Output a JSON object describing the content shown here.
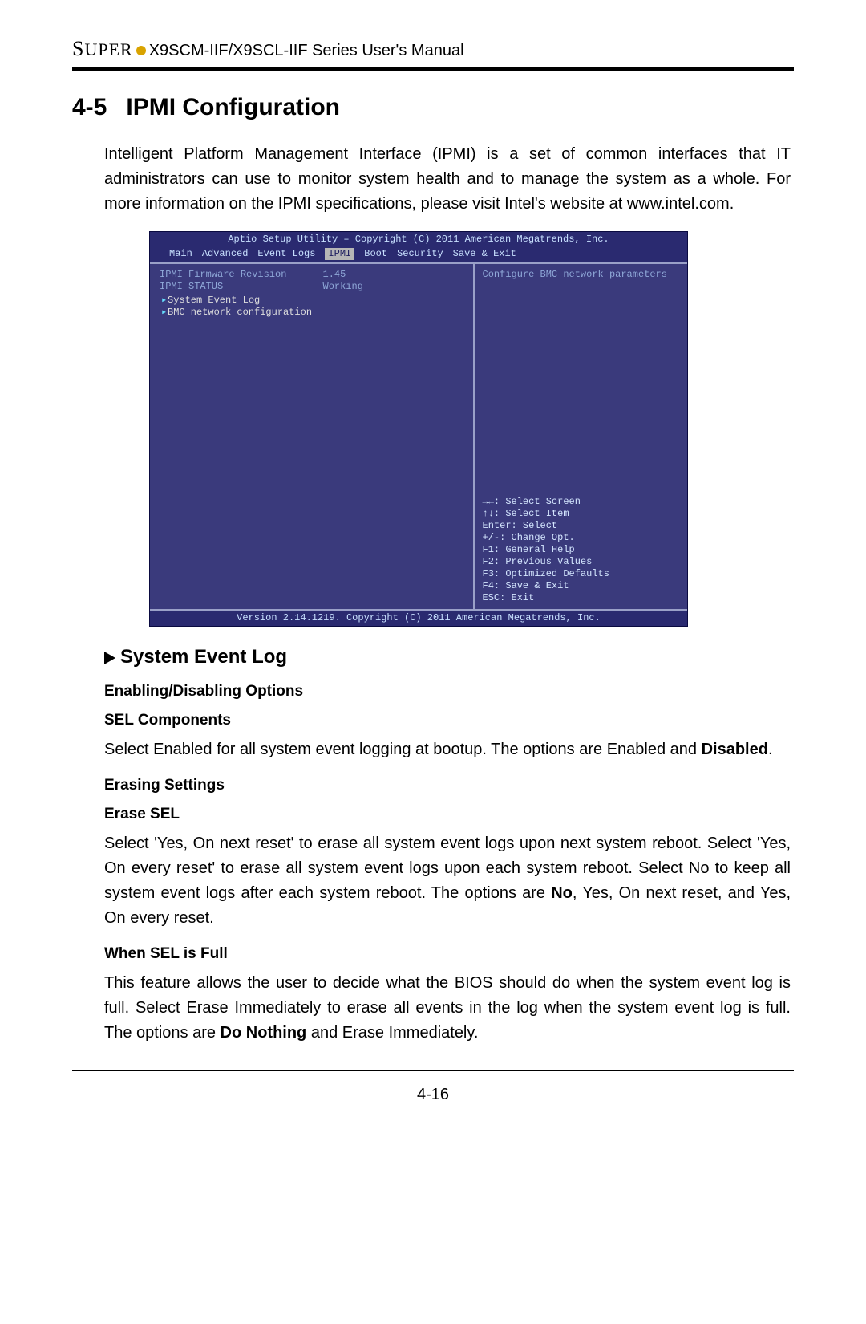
{
  "header": {
    "brand": "SUPER",
    "title": "X9SCM-IIF/X9SCL-IIF Series User's Manual"
  },
  "section": {
    "number": "4-5",
    "title": "IPMI Configuration",
    "intro": "Intelligent Platform Management Interface (IPMI) is a set of common interfaces that IT administrators can use to monitor system health and to manage the system as a whole. For more information on the IPMI specifications, please visit Intel's website at www.intel.com."
  },
  "bios": {
    "topbar": "Aptio Setup Utility – Copyright (C) 2011 American Megatrends, Inc.",
    "menu": [
      "Main",
      "Advanced",
      "Event Logs",
      "IPMI",
      "Boot",
      "Security",
      "Save & Exit"
    ],
    "menu_selected": "IPMI",
    "rows": [
      {
        "label": "IPMI Firmware Revision",
        "value": "1.45"
      },
      {
        "label": "IPMI STATUS",
        "value": "Working"
      }
    ],
    "subitems": [
      "System Event Log",
      "BMC network configuration"
    ],
    "help_top": "Configure BMC network parameters",
    "help_keys": [
      "→←: Select Screen",
      "↑↓: Select Item",
      "Enter: Select",
      "+/-: Change Opt.",
      "F1: General Help",
      "F2: Previous Values",
      "F3: Optimized Defaults",
      "F4: Save & Exit",
      "ESC: Exit"
    ],
    "bottombar": "Version 2.14.1219. Copyright (C) 2011 American Megatrends, Inc."
  },
  "subsection": {
    "title": "System Event Log",
    "group1": "Enabling/Disabling Options",
    "opt1_name": "SEL Components",
    "opt1_text_a": "Select Enabled for all system event logging at bootup. The options are Enabled and ",
    "opt1_bold": "Disabled",
    "opt1_text_b": ".",
    "group2": "Erasing Settings",
    "opt2_name": "Erase SEL",
    "opt2_text_a": "Select 'Yes, On next reset' to erase all system event logs upon next system reboot. Select 'Yes, On every reset' to erase all system event logs upon each system reboot. Select No to keep all system event logs after each system reboot. The options are ",
    "opt2_bold": "No",
    "opt2_text_b": ", Yes, On next reset, and Yes, On every reset.",
    "opt3_name": "When SEL is Full",
    "opt3_text_a": "This feature allows the user to decide what the BIOS should do when the system event log is full. Select Erase Immediately to erase all events in the log when the system event log is full. The options are ",
    "opt3_bold": "Do Nothing",
    "opt3_text_b": " and Erase Immediately."
  },
  "footer": {
    "page": "4-16"
  }
}
